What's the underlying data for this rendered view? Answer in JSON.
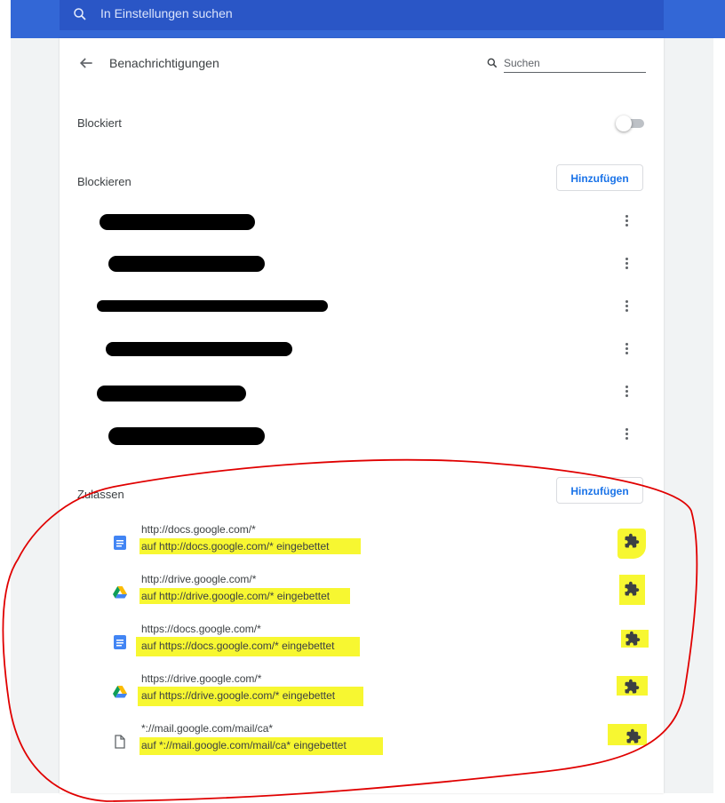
{
  "header": {
    "search_placeholder": "In Einstellungen suchen"
  },
  "page": {
    "title": "Benachrichtigungen",
    "search_placeholder": "Suchen",
    "blocked_toggle_label": "Blockiert",
    "blocked_toggle_on": false
  },
  "block_section": {
    "heading": "Blockieren",
    "add_button": "Hinzufügen",
    "redacted_entries_count": 6
  },
  "allow_section": {
    "heading": "Zulassen",
    "add_button": "Hinzufügen",
    "items": [
      {
        "icon": "docs-icon",
        "url": "http://docs.google.com/*",
        "embedded": "auf http://docs.google.com/* eingebettet"
      },
      {
        "icon": "drive-icon",
        "url": "http://drive.google.com/*",
        "embedded": "auf http://drive.google.com/* eingebettet"
      },
      {
        "icon": "docs-icon",
        "url": "https://docs.google.com/*",
        "embedded": "auf https://docs.google.com/* eingebettet"
      },
      {
        "icon": "drive-icon",
        "url": "https://drive.google.com/*",
        "embedded": "auf https://drive.google.com/* eingebettet"
      },
      {
        "icon": "file-icon",
        "url": "*://mail.google.com/mail/ca*",
        "embedded": "auf *://mail.google.com/mail/ca* eingebettet"
      }
    ]
  },
  "colors": {
    "topbar": "#3367d6",
    "searchbox": "#2a56c6",
    "accent": "#1a73e8",
    "highlight": "#f7f731",
    "annotation": "#e00000"
  }
}
